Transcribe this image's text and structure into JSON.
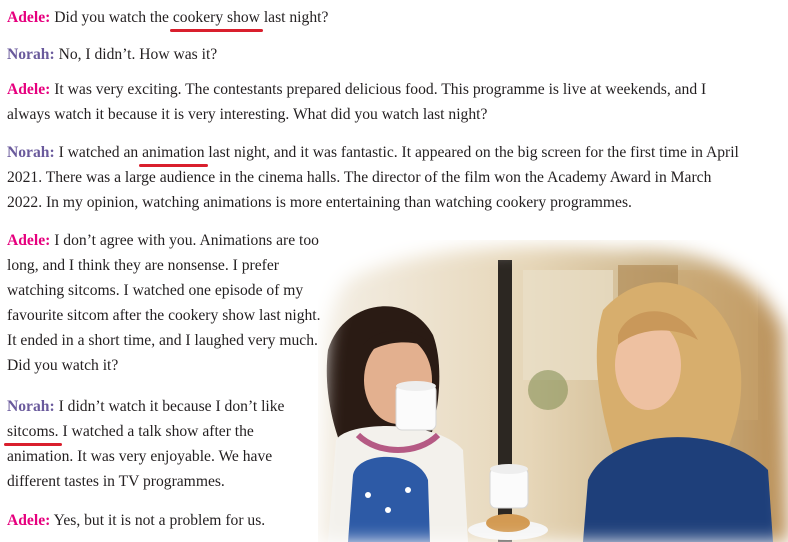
{
  "dialogue": {
    "p1": {
      "speaker": "Adele:",
      "t1": "Did you watch the ",
      "hl": "cookery show",
      "t2": " last night?"
    },
    "p2": {
      "speaker": "Norah:",
      "text": "No, I didn’t. How was it?"
    },
    "p3": {
      "speaker": "Adele:",
      "text": "It was very exciting. The contestants prepared delicious food. This programme is live at weekends, and I always watch it because it is very interesting. What did you watch last night?"
    },
    "p4": {
      "speaker": "Norah:",
      "t1": "I watched an ",
      "hl": "animation",
      "t2": " last night, and it was fantastic. It appeared on the big screen for the first time in April 2021. There was a large audience in the cinema halls. The director of the film won the Academy Award in March 2022. In my opinion, watching animations is more entertaining than watching cookery programmes."
    },
    "p5": {
      "speaker": "Adele:",
      "text": "I don’t agree with you. Animations are too long, and I think they are nonsense. I prefer watching sitcoms. I watched one episode of my favourite sitcom after the cookery show last night. It ended in a short time, and I laughed very much. Did you watch it?"
    },
    "p6": {
      "speaker": "Norah:",
      "t1": "I didn’t watch it because I don’t like ",
      "hl": "sitcoms.",
      "t2": " I watched a talk show after the animation. It was very enjoyable. We have different tastes in TV programmes."
    },
    "p7": {
      "speaker": "Adele:",
      "text": "Yes, but it is not a problem for us."
    }
  },
  "colors": {
    "adele": "#e6007e",
    "norah": "#6a5a9c",
    "underline": "#d91f2d"
  }
}
